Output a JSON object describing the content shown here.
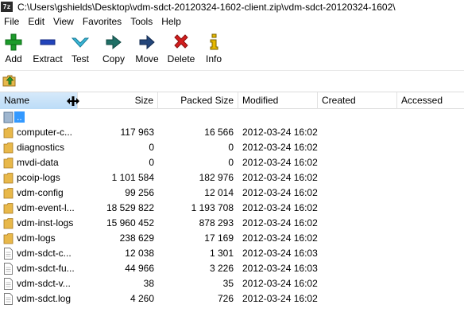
{
  "window": {
    "app_icon_text": "7z",
    "title": "C:\\Users\\gshields\\Desktop\\vdm-sdct-20120324-1602-client.zip\\vdm-sdct-20120324-1602\\"
  },
  "menu": [
    {
      "label": "File"
    },
    {
      "label": "Edit"
    },
    {
      "label": "View"
    },
    {
      "label": "Favorites"
    },
    {
      "label": "Tools"
    },
    {
      "label": "Help"
    }
  ],
  "toolbar": [
    {
      "label": "Add",
      "icon": "plus-icon"
    },
    {
      "label": "Extract",
      "icon": "minus-icon"
    },
    {
      "label": "Test",
      "icon": "check-icon"
    },
    {
      "label": "Copy",
      "icon": "double-arrow-icon"
    },
    {
      "label": "Move",
      "icon": "arrow-right-icon"
    },
    {
      "label": "Delete",
      "icon": "delete-x-icon"
    },
    {
      "label": "Info",
      "icon": "info-icon"
    }
  ],
  "address": {
    "value": "",
    "icon": "folder-up-icon"
  },
  "columns": {
    "name": "Name",
    "size": "Size",
    "packed": "Packed Size",
    "modified": "Modified",
    "created": "Created",
    "accessed": "Accessed"
  },
  "files": [
    {
      "name": "..",
      "size": "",
      "packed": "",
      "modified": "",
      "type": "parent"
    },
    {
      "name": "computer-c...",
      "size": "117 963",
      "packed": "16 566",
      "modified": "2012-03-24 16:02",
      "type": "folder"
    },
    {
      "name": "diagnostics",
      "size": "0",
      "packed": "0",
      "modified": "2012-03-24 16:02",
      "type": "folder"
    },
    {
      "name": "mvdi-data",
      "size": "0",
      "packed": "0",
      "modified": "2012-03-24 16:02",
      "type": "folder"
    },
    {
      "name": "pcoip-logs",
      "size": "1 101 584",
      "packed": "182 976",
      "modified": "2012-03-24 16:02",
      "type": "folder"
    },
    {
      "name": "vdm-config",
      "size": "99 256",
      "packed": "12 014",
      "modified": "2012-03-24 16:02",
      "type": "folder"
    },
    {
      "name": "vdm-event-l...",
      "size": "18 529 822",
      "packed": "1 193 708",
      "modified": "2012-03-24 16:02",
      "type": "folder"
    },
    {
      "name": "vdm-inst-logs",
      "size": "15 960 452",
      "packed": "878 293",
      "modified": "2012-03-24 16:02",
      "type": "folder"
    },
    {
      "name": "vdm-logs",
      "size": "238 629",
      "packed": "17 169",
      "modified": "2012-03-24 16:02",
      "type": "folder"
    },
    {
      "name": "vdm-sdct-c...",
      "size": "12 038",
      "packed": "1 301",
      "modified": "2012-03-24 16:03",
      "type": "file"
    },
    {
      "name": "vdm-sdct-fu...",
      "size": "44 966",
      "packed": "3 226",
      "modified": "2012-03-24 16:03",
      "type": "file"
    },
    {
      "name": "vdm-sdct-v...",
      "size": "38",
      "packed": "35",
      "modified": "2012-03-24 16:02",
      "type": "file"
    },
    {
      "name": "vdm-sdct.log",
      "size": "4 260",
      "packed": "726",
      "modified": "2012-03-24 16:02",
      "type": "file"
    }
  ],
  "colors": {
    "selection": "#3399ff",
    "folder": "#e8b84a",
    "header_active": "#c9e3f8"
  }
}
